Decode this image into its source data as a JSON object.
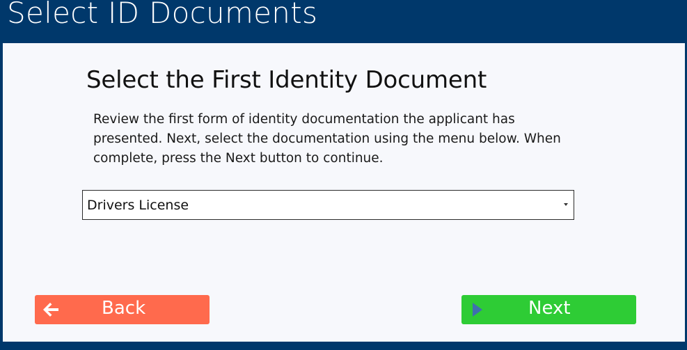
{
  "window": {
    "title": "Select ID Documents"
  },
  "content": {
    "heading": "Select the First Identity Document",
    "instructions": "Review the first form of identity documentation the applicant has presented. Next, select the documentation using the menu below. When complete, press the Next button to continue."
  },
  "document_select": {
    "selected": "Drivers License",
    "icon": "caret-down-icon"
  },
  "buttons": {
    "back": {
      "label": "Back",
      "icon": "arrow-left-icon",
      "color": "#ff6a4d"
    },
    "next": {
      "label": "Next",
      "icon": "play-icon",
      "color": "#2ecc35"
    }
  },
  "colors": {
    "frame": "#00386b",
    "panel": "#f7f8fc"
  }
}
